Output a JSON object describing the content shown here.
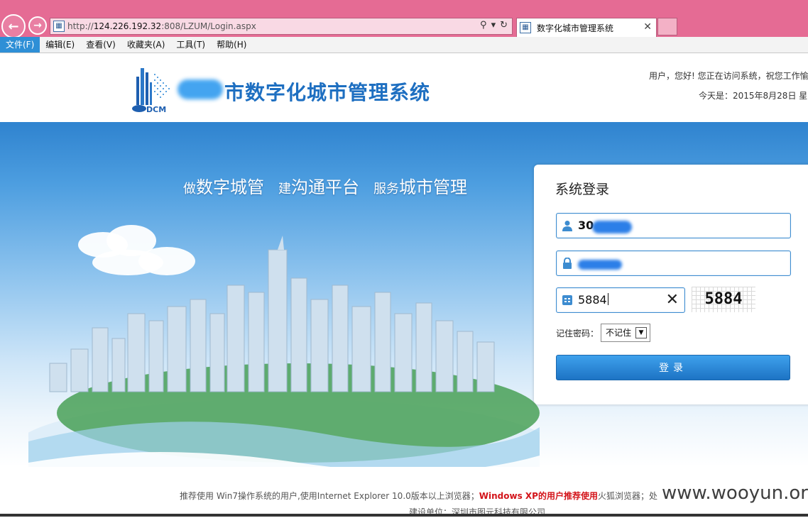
{
  "browser": {
    "address_scheme": "http://",
    "address_host": "124.226.192.32",
    "address_rest": ":808/LZUM/Login.aspx",
    "tab_title": "数字化城市管理系统",
    "back_icon": "back-arrow-icon",
    "forward_icon": "forward-arrow-icon"
  },
  "menu": [
    {
      "label": "文件(F)"
    },
    {
      "label": "编辑(E)"
    },
    {
      "label": "查看(V)"
    },
    {
      "label": "收藏夹(A)"
    },
    {
      "label": "工具(T)"
    },
    {
      "label": "帮助(H)"
    }
  ],
  "header": {
    "logo_text": "DCM",
    "title": "市数字化城市管理系统",
    "greeting": "用户，您好! 您正在访问系统，祝您工作愉",
    "today": "今天是：2015年8月28日 星"
  },
  "banner": {
    "slogan": [
      {
        "small": "做",
        "big": "数字城管"
      },
      {
        "small": "建",
        "big": "沟通平台"
      },
      {
        "small": "服务",
        "big": "城市管理"
      }
    ]
  },
  "login": {
    "title": "系统登录",
    "username_value": "30",
    "captcha_value": "5884",
    "captcha_image_text": "5884",
    "clear_icon": "✕",
    "remember_label": "记住密码：",
    "remember_selected": "不记住",
    "submit_label": "登录"
  },
  "footer": {
    "notice_part1": "推荐使用 Win7操作系统的用户,使用Internet Explorer 10.0版本以上浏览器；",
    "notice_warn": "Windows XP的用户推荐使用",
    "notice_part2": "火狐浏览器；处",
    "builder": "建设单位：深圳市图元科技有限公司",
    "watermark": "www.wooyun.org"
  },
  "colors": {
    "chrome": "#e56b94",
    "accent": "#2e8fd6",
    "title_blue": "#1e6fc1",
    "warn_red": "#d3141a"
  }
}
